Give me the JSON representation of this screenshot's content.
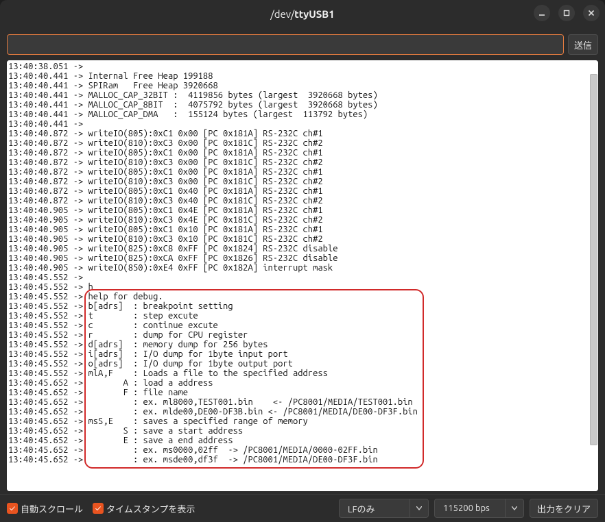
{
  "title": {
    "prefix": "/dev/",
    "name": "ttyUSB1"
  },
  "input_value": "",
  "send_label": "送信",
  "terminal_lines": [
    "13:40:38.051 -> ",
    "13:40:40.441 -> Internal Free Heap 199188",
    "13:40:40.441 -> SPIRam   Free Heap 3920668",
    "13:40:40.441 -> MALLOC_CAP_32BIT :  4119856 bytes (largest  3920668 bytes)",
    "13:40:40.441 -> MALLOC_CAP_8BIT  :  4075792 bytes (largest  3920668 bytes)",
    "13:40:40.441 -> MALLOC_CAP_DMA   :  155124 bytes (largest  113792 bytes)",
    "13:40:40.441 -> ",
    "13:40:40.872 -> writeIO(805):0xC1 0x00 [PC 0x181A] RS-232C ch#1",
    "13:40:40.872 -> writeIO(810):0xC3 0x00 [PC 0x181C] RS-232C ch#2",
    "13:40:40.872 -> writeIO(805):0xC1 0x00 [PC 0x181A] RS-232C ch#1",
    "13:40:40.872 -> writeIO(810):0xC3 0x00 [PC 0x181C] RS-232C ch#2",
    "13:40:40.872 -> writeIO(805):0xC1 0x00 [PC 0x181A] RS-232C ch#1",
    "13:40:40.872 -> writeIO(810):0xC3 0x00 [PC 0x181C] RS-232C ch#2",
    "13:40:40.872 -> writeIO(805):0xC1 0x40 [PC 0x181A] RS-232C ch#1",
    "13:40:40.872 -> writeIO(810):0xC3 0x40 [PC 0x181C] RS-232C ch#2",
    "13:40:40.905 -> writeIO(805):0xC1 0x4E [PC 0x181A] RS-232C ch#1",
    "13:40:40.905 -> writeIO(810):0xC3 0x4E [PC 0x181C] RS-232C ch#2",
    "13:40:40.905 -> writeIO(805):0xC1 0x10 [PC 0x181A] RS-232C ch#1",
    "13:40:40.905 -> writeIO(810):0xC3 0x10 [PC 0x181C] RS-232C ch#2",
    "13:40:40.905 -> writeIO(825):0xC8 0xFF [PC 0x1824] RS-232C disable",
    "13:40:40.905 -> writeIO(825):0xCA 0xFF [PC 0x1826] RS-232C disable",
    "13:40:40.905 -> writeIO(850):0xE4 0xFF [PC 0x182A] interrupt mask",
    "13:40:45.552 -> ",
    "13:40:45.552 -> h",
    "13:40:45.552 -> help for debug.",
    "13:40:45.552 -> b[adrs]  : breakpoint setting",
    "13:40:45.552 -> t        : step excute",
    "13:40:45.552 -> c        : continue excute",
    "13:40:45.552 -> r        : dump for CPU register",
    "13:40:45.552 -> d[adrs]  : memory dump for 256 bytes",
    "13:40:45.552 -> i[adrs]  : I/O dump for 1byte input port",
    "13:40:45.552 -> o[adrs]  : I/O dump for 1byte output port",
    "13:40:45.552 -> mlA,F    : Loads a file to the specified address",
    "13:40:45.652 ->        A : load a address",
    "13:40:45.652 ->        F : file name",
    "13:40:45.652 ->          : ex. ml8000,TEST001.bin    <- /PC8001/MEDIA/TEST001.bin",
    "13:40:45.652 ->          : ex. mlde00,DE00-DF3B.bin <- /PC8001/MEDIA/DE00-DF3F.bin",
    "13:40:45.652 -> msS,E    : saves a specified range of memory",
    "13:40:45.652 ->        S : save a start address",
    "13:40:45.652 ->        E : save a end address",
    "13:40:45.652 ->          : ex. ms0000,02ff  -> /PC8001/MEDIA/0000-02FF.bin",
    "13:40:45.652 ->          : ex. msde00,df3f  -> /PC8001/MEDIA/DE00-DF3F.bin"
  ],
  "highlight": {
    "top_line": 24,
    "bottom_line": 41,
    "left_ch": 16,
    "right_ch": 83
  },
  "footer": {
    "autoscroll": "自動スクロール",
    "timestamp": "タイムスタンプを表示",
    "lineending": "LFのみ",
    "baud": "115200 bps",
    "clear": "出力をクリア"
  }
}
